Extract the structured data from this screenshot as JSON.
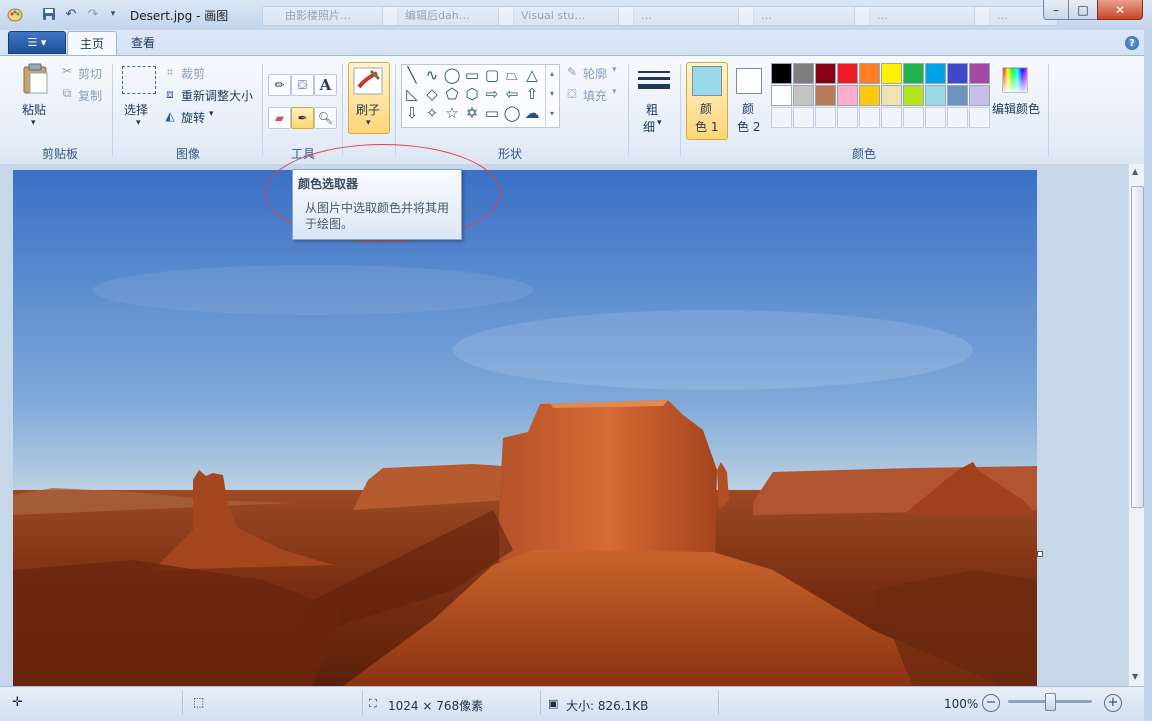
{
  "window": {
    "title": "Desert.jpg - 画图",
    "controls": {
      "minimize": "–",
      "maximize": "□",
      "close": "✕"
    },
    "ghost_tabs": [
      "由影楼照片…",
      "编辑后dah…",
      "Visual stu…",
      "…",
      "…",
      "…",
      "…",
      "…"
    ]
  },
  "ribbon": {
    "tabs": [
      "主页",
      "查看"
    ],
    "active_tab": "主页",
    "help": "?",
    "clipboard": {
      "paste": "粘贴",
      "cut": "剪切",
      "copy": "复制",
      "label": "剪贴板"
    },
    "image": {
      "select": "选择",
      "crop": "裁剪",
      "resize": "重新调整大小",
      "rotate": "旋转",
      "label": "图像"
    },
    "tools": {
      "label": "工具"
    },
    "brush": {
      "label": "刷子"
    },
    "shapes": {
      "outline": "轮廓",
      "fill": "填充",
      "label": "形状"
    },
    "size": {
      "label_line1": "粗",
      "label_line2": "细"
    },
    "colors": {
      "color1_line1": "颜",
      "color1_line2": "色 1",
      "color2_line1": "颜",
      "color2_line2": "色 2",
      "edit": "编辑颜色",
      "label": "颜色",
      "color1_value": "#99d9ea",
      "color2_value": "#ffffff",
      "palette_row1": [
        "#000000",
        "#7f7f7f",
        "#880015",
        "#ed1c24",
        "#ff7f27",
        "#fff200",
        "#22b14c",
        "#00a2e8",
        "#3f48cc",
        "#a349a4"
      ],
      "palette_row2": [
        "#ffffff",
        "#c3c3c3",
        "#b97a57",
        "#ffaec9",
        "#ffc90e",
        "#efe4b0",
        "#b5e61d",
        "#99d9ea",
        "#7092be",
        "#c8bfe7"
      ]
    }
  },
  "tooltip": {
    "title": "颜色选取器",
    "body": "从图片中选取颜色并将其用于绘图。"
  },
  "status": {
    "dimensions": "1024 × 768像素",
    "size": "大小: 826.1KB",
    "zoom": "100%",
    "zoom_level": 1.0
  }
}
